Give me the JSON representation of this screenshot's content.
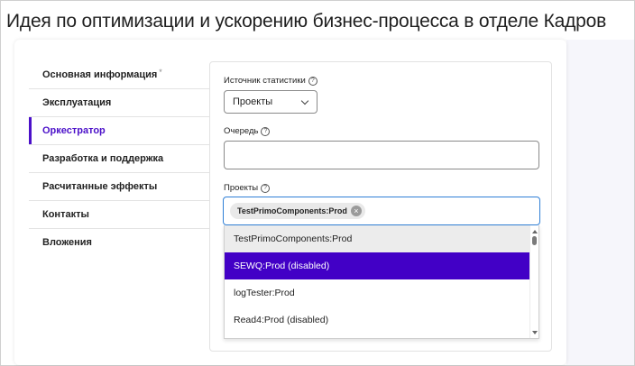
{
  "page": {
    "title": "Идея по оптимизации и ускорению бизнес-процесса в отделе Кадров"
  },
  "sidebar": {
    "items": [
      {
        "label": "Основная информация",
        "required_mark": "*",
        "active": false
      },
      {
        "label": "Эксплуатация",
        "active": false
      },
      {
        "label": "Оркестратор",
        "active": true
      },
      {
        "label": "Разработка и поддержка",
        "active": false
      },
      {
        "label": "Расчитанные эффекты",
        "active": false
      },
      {
        "label": "Контакты",
        "active": false
      },
      {
        "label": "Вложения",
        "active": false
      }
    ]
  },
  "form": {
    "stats_source": {
      "label": "Источник статистики",
      "help": "?",
      "value": "Проекты"
    },
    "queue": {
      "label": "Очередь",
      "help": "?",
      "value": ""
    },
    "projects": {
      "label": "Проекты",
      "help": "?",
      "selected_chips": [
        "TestPrimoComponents:Prod"
      ],
      "chip_remove": "×",
      "options": [
        {
          "label": "TestPrimoComponents:Prod",
          "state": "hover"
        },
        {
          "label": "SEWQ:Prod (disabled)",
          "state": "selected"
        },
        {
          "label": "logTester:Prod",
          "state": "normal"
        },
        {
          "label": "Read4:Prod (disabled)",
          "state": "normal"
        }
      ]
    }
  },
  "colors": {
    "accent": "#4b10c9",
    "selected_option": "#4200c6",
    "focus_border": "#2f7fd6"
  }
}
